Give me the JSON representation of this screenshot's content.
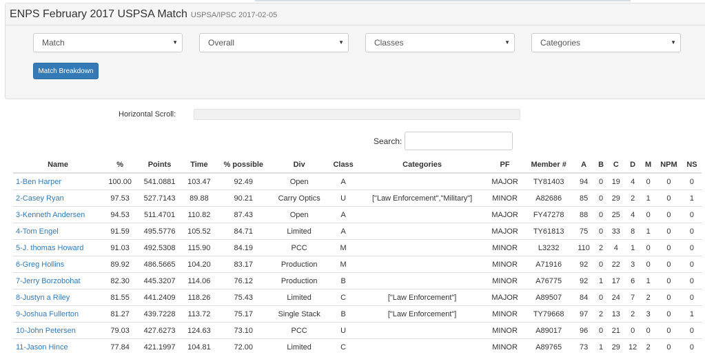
{
  "header": {
    "title": "ENPS February 2017 USPSA Match",
    "subtitle": "USPSA/IPSC 2017-02-05"
  },
  "filters": {
    "match": "Match",
    "overall": "Overall",
    "classes": "Classes",
    "categories": "Categories"
  },
  "breakdown_button": "Match Breakdown",
  "horizontal_scroll_label": "Horizontal Scroll:",
  "search": {
    "label": "Search:",
    "value": ""
  },
  "colors": {
    "link": "#337ab7",
    "major": "#337ab7",
    "minor": "#a94442",
    "primary": "#337ab7"
  },
  "table": {
    "columns": [
      "Name",
      "%",
      "Points",
      "Time",
      "% possible",
      "Div",
      "Class",
      "Categories",
      "PF",
      "Member #",
      "A",
      "B",
      "C",
      "D",
      "M",
      "NPM",
      "NS"
    ],
    "rows": [
      [
        "1-Ben Harper",
        "100.00",
        "541.0881",
        "103.47",
        "92.49",
        "Open",
        "A",
        "",
        "MAJOR",
        "TY81403",
        "94",
        "0",
        "19",
        "4",
        "0",
        "0",
        "0"
      ],
      [
        "2-Casey Ryan",
        "97.53",
        "527.7143",
        "89.88",
        "90.21",
        "Carry Optics",
        "U",
        "[\"Law Enforcement\",\"Military\"]",
        "MINOR",
        "A82686",
        "85",
        "0",
        "29",
        "2",
        "1",
        "0",
        "1"
      ],
      [
        "3-Kenneth Andersen",
        "94.53",
        "511.4701",
        "110.82",
        "87.43",
        "Open",
        "A",
        "",
        "MAJOR",
        "FY47278",
        "88",
        "0",
        "25",
        "4",
        "0",
        "0",
        "0"
      ],
      [
        "4-Tom Engel",
        "91.59",
        "495.5776",
        "105.52",
        "84.71",
        "Limited",
        "A",
        "",
        "MAJOR",
        "TY61813",
        "75",
        "0",
        "33",
        "8",
        "1",
        "0",
        "0"
      ],
      [
        "5-J. thomas Howard",
        "91.03",
        "492.5308",
        "115.90",
        "84.19",
        "PCC",
        "M",
        "",
        "MINOR",
        "L3232",
        "110",
        "2",
        "4",
        "1",
        "0",
        "0",
        "0"
      ],
      [
        "6-Greg Hollins",
        "89.92",
        "486.5665",
        "104.20",
        "83.17",
        "Production",
        "M",
        "",
        "MINOR",
        "A71916",
        "92",
        "0",
        "22",
        "3",
        "0",
        "0",
        "0"
      ],
      [
        "7-Jerry Borzobohat",
        "82.30",
        "445.3207",
        "114.06",
        "76.12",
        "Production",
        "B",
        "",
        "MINOR",
        "A76775",
        "92",
        "1",
        "17",
        "6",
        "1",
        "0",
        "0"
      ],
      [
        "8-Justyn a Riley",
        "81.55",
        "441.2409",
        "118.26",
        "75.43",
        "Limited",
        "C",
        "[\"Law Enforcement\"]",
        "MAJOR",
        "A89507",
        "84",
        "0",
        "24",
        "7",
        "2",
        "0",
        "0"
      ],
      [
        "9-Joshua Fullerton",
        "81.27",
        "439.7228",
        "113.72",
        "75.17",
        "Single Stack",
        "B",
        "[\"Law Enforcement\"]",
        "MINOR",
        "TY79668",
        "97",
        "2",
        "13",
        "2",
        "3",
        "0",
        "1"
      ],
      [
        "10-John Petersen",
        "79.03",
        "427.6273",
        "124.63",
        "73.10",
        "PCC",
        "U",
        "",
        "MINOR",
        "A89017",
        "96",
        "0",
        "21",
        "0",
        "0",
        "0",
        "0"
      ],
      [
        "11-Jason Hince",
        "77.84",
        "421.1997",
        "104.81",
        "72.00",
        "Limited",
        "C",
        "",
        "MINOR",
        "A89765",
        "73",
        "1",
        "29",
        "12",
        "2",
        "0",
        "0"
      ]
    ]
  }
}
